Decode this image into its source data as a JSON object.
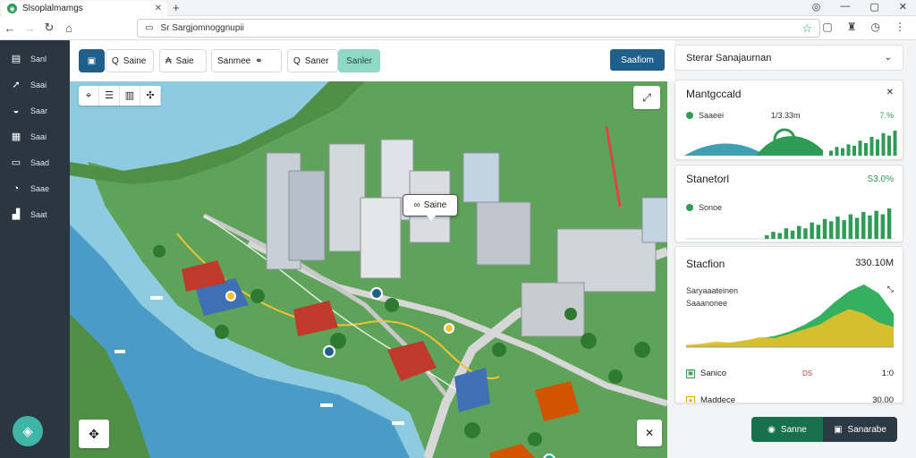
{
  "browser": {
    "tab_title": "Slsoplalmamgs",
    "url": "Sr Sargjomnoggnupii",
    "nav": {
      "back": "←",
      "forward": "→",
      "reload": "↻",
      "home": "⌂"
    }
  },
  "sidebar": {
    "items": [
      {
        "icon": "▤",
        "label": "Sanl"
      },
      {
        "icon": "➚",
        "label": "Saai"
      },
      {
        "icon": "◒",
        "label": "Saar"
      },
      {
        "icon": "▦",
        "label": "Saai"
      },
      {
        "icon": "▭",
        "label": "Saad"
      },
      {
        "icon": "◔",
        "label": "Saae"
      },
      {
        "icon": "▟",
        "label": "Saat"
      }
    ]
  },
  "toolbar": {
    "buttons": [
      {
        "icon": "▣",
        "label": ""
      },
      {
        "icon": "Q",
        "label": "Saine"
      },
      {
        "icon": "₳",
        "label": "Saie"
      },
      {
        "icon": "⚭",
        "label": "Sanmee"
      },
      {
        "icon": "Q",
        "label": "Saner"
      },
      {
        "icon": "",
        "label": "Sanler"
      }
    ],
    "primary": "Saafiom"
  },
  "map": {
    "callout": {
      "icon": "∞",
      "label": "Saine"
    }
  },
  "panel": {
    "header": "Sterar Sanajaurnan",
    "cards": [
      {
        "title": "Mantgccald",
        "row_label": "Saaeei",
        "row_mid": "1/3.33m",
        "value": "7.%",
        "bars": [
          4,
          7,
          6,
          9,
          8,
          12,
          10,
          15,
          13,
          18,
          16,
          20
        ]
      },
      {
        "title": "Stanetorl",
        "value": "S3.0%",
        "row_label": "Sonoe",
        "bars": [
          3,
          6,
          5,
          9,
          7,
          11,
          9,
          14,
          12,
          17,
          15,
          19,
          16,
          21,
          18,
          23,
          20,
          24,
          21,
          26
        ]
      },
      {
        "title": "Stacfion",
        "value": "330.10M",
        "legend": [
          "Saryaaateinen",
          "Saaanonee"
        ],
        "area_a": [
          2,
          3,
          5,
          4,
          6,
          9,
          8,
          12,
          16,
          20,
          28,
          34,
          30,
          22,
          18
        ],
        "area_b": [
          1,
          2,
          3,
          4,
          6,
          8,
          10,
          14,
          20,
          28,
          40,
          50,
          56,
          48,
          30
        ]
      }
    ],
    "summary": [
      {
        "icon": "▣",
        "label": "Sanico",
        "mid": "DS",
        "value": "1:0"
      },
      {
        "icon": "▲",
        "label": "Maddece",
        "mid": "",
        "value": "30,00"
      }
    ]
  },
  "actions": {
    "green": "Sanne",
    "dark": "Sanarabe"
  },
  "colors": {
    "accent": "#1f5f8b",
    "green": "#2e9c57",
    "water": "#8ccbe0"
  }
}
